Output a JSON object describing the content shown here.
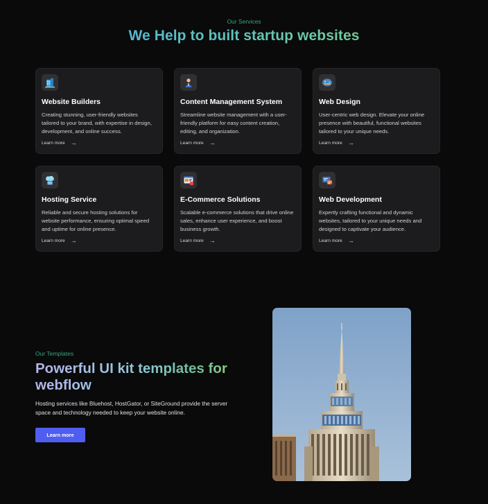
{
  "services": {
    "eyebrow": "Our Services",
    "title": "We Help to built startup websites",
    "cards": [
      {
        "icon": "building-icon",
        "title": "Website Builders",
        "description": "Creating stunning, user-friendly websites tailored to your brand, with expertise in design, development, and online success.",
        "link_label": "Learn more"
      },
      {
        "icon": "person-icon",
        "title": "Content Management System",
        "description": "Streamline website management with a user-friendly platform for easy content creation, editing, and organization.",
        "link_label": "Learn more"
      },
      {
        "icon": "palette-icon",
        "title": "Web Design",
        "description": "User-centric web design. Elevate your online presence with beautiful, functional websites tailored to your unique needs.",
        "link_label": "Learn more"
      },
      {
        "icon": "cloud-server-icon",
        "title": "Hosting Service",
        "description": "Reliable and secure hosting solutions for website performance, ensuring optimal speed and uptime for online presence.",
        "link_label": "Learn more"
      },
      {
        "icon": "storefront-icon",
        "title": "E-Commerce Solutions",
        "description": "Scalable e-commerce solutions that drive online sales, enhance user experience, and boost business growth.",
        "link_label": "Learn more"
      },
      {
        "icon": "code-window-icon",
        "title": "Web Development",
        "description": "Expertly crafting functional and dynamic websites, tailored to your unique needs and designed to captivate your audience.",
        "link_label": "Learn more"
      }
    ]
  },
  "templates": {
    "eyebrow": "Our Templates",
    "title": "Powerful UI kit templates for webflow",
    "description": "Hosting services like Bluehost, HostGator, or SiteGround provide the server space and technology needed to keep your website online.",
    "button_label": "Learn more",
    "accent_color": "#4f5ef0"
  }
}
